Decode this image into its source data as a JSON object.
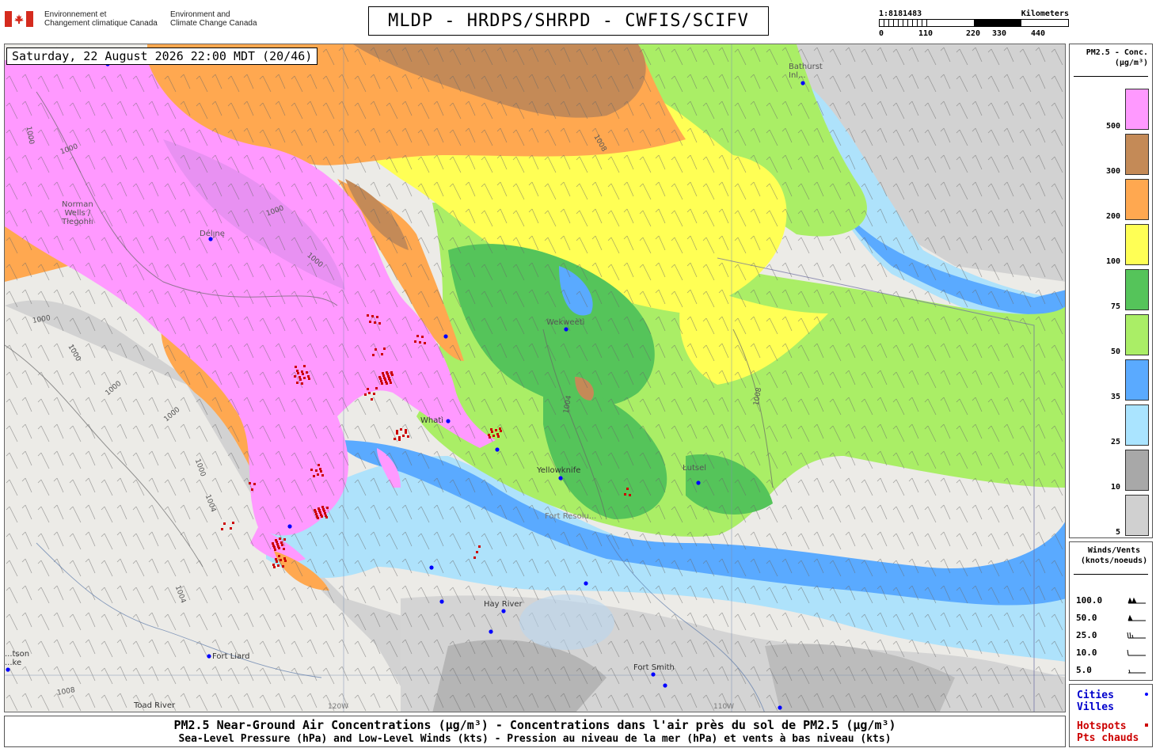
{
  "header": {
    "agency_fr_line1": "Environnement et",
    "agency_fr_line2": "Changement climatique Canada",
    "agency_en_line1": "Environment and",
    "agency_en_line2": "Climate Change Canada",
    "title": "MLDP - HRDPS/SHRPD - CWFIS/SCIFV"
  },
  "scale": {
    "ratio": "1:8181483",
    "unit": "Kilometers",
    "ticks": [
      "0",
      "110",
      "220",
      "330",
      "440"
    ]
  },
  "map": {
    "datetime": "Saturday, 22 August 2026 22:00 MDT (20/46)",
    "cities": [
      {
        "name": "Norman Wells / Tłegohłı",
        "lines": [
          "Norman",
          "Wells /",
          "Tłegohłı"
        ]
      },
      {
        "name": "Délı̨nę",
        "lines": [
          "Délı̨nę"
        ]
      },
      {
        "name": "Bathurst Inlet",
        "lines": [
          "Bathurst",
          "Inl..."
        ]
      },
      {
        "name": "Wekweètì",
        "lines": [
          "Wekweètì"
        ]
      },
      {
        "name": "Whatì",
        "lines": [
          "Whatì"
        ]
      },
      {
        "name": "Yellowknife",
        "lines": [
          "Yellowknife"
        ]
      },
      {
        "name": "Łutsël K'é",
        "lines": [
          "Łutsel"
        ]
      },
      {
        "name": "Fort Resolution",
        "lines": [
          "Fort Resolu..."
        ]
      },
      {
        "name": "Hay River",
        "lines": [
          "Hay River"
        ]
      },
      {
        "name": "Fort Liard",
        "lines": [
          "Fort Liard"
        ]
      },
      {
        "name": "Fort Smith",
        "lines": [
          "Fort Smith"
        ]
      },
      {
        "name": "Toad River",
        "lines": [
          "Toad River"
        ]
      },
      {
        "name": "Fort Nelson",
        "lines": [
          "...tson",
          "...ke"
        ]
      }
    ],
    "graticule_labels": [
      "120W",
      "110W"
    ],
    "isobar_labels": [
      "1000",
      "1000",
      "1000",
      "1000",
      "1000",
      "1000",
      "1000",
      "1000",
      "1000",
      "1004",
      "1004",
      "1004",
      "1008",
      "1008",
      "1008"
    ]
  },
  "legend_pm": {
    "title_line1": "PM2.5 - Conc.",
    "title_line2": "(µg/m³)",
    "bins": [
      {
        "label": "500",
        "color": "#ff99ff"
      },
      {
        "label": "300",
        "color": "#c48a57"
      },
      {
        "label": "200",
        "color": "#ffa850"
      },
      {
        "label": "100",
        "color": "#ffff55"
      },
      {
        "label": "75",
        "color": "#55c45a"
      },
      {
        "label": "50",
        "color": "#aaee66"
      },
      {
        "label": "35",
        "color": "#5aaaff"
      },
      {
        "label": "25",
        "color": "#aae4ff"
      },
      {
        "label": "10",
        "color": "#a8a8a8"
      },
      {
        "label": "5",
        "color": "#d0d0d0"
      }
    ]
  },
  "legend_wind": {
    "title_line1": "Winds/Vents",
    "title_line2": "(knots/noeuds)",
    "rows": [
      {
        "label": "100.0",
        "icon": "barb-100-icon"
      },
      {
        "label": "50.0",
        "icon": "barb-50-icon"
      },
      {
        "label": "25.0",
        "icon": "barb-25-icon"
      },
      {
        "label": "10.0",
        "icon": "barb-10-icon"
      },
      {
        "label": "5.0",
        "icon": "barb-5-icon"
      }
    ]
  },
  "legend_points": {
    "cities_en": "Cities",
    "cities_fr": "Villes",
    "hotspots_en": "Hotspots",
    "hotspots_fr": "Pts chauds",
    "city_color": "#0000ff",
    "hotspot_color": "#cc0000"
  },
  "captions": {
    "line1": "PM2.5 Near-Ground Air Concentrations (µg/m³) - Concentrations dans l'air près du sol de PM2.5 (µg/m³)",
    "line2": "Sea-Level Pressure (hPa) and Low-Level Winds (kts) - Pression au niveau de la mer (hPa) et vents à bas niveau (kts)"
  }
}
